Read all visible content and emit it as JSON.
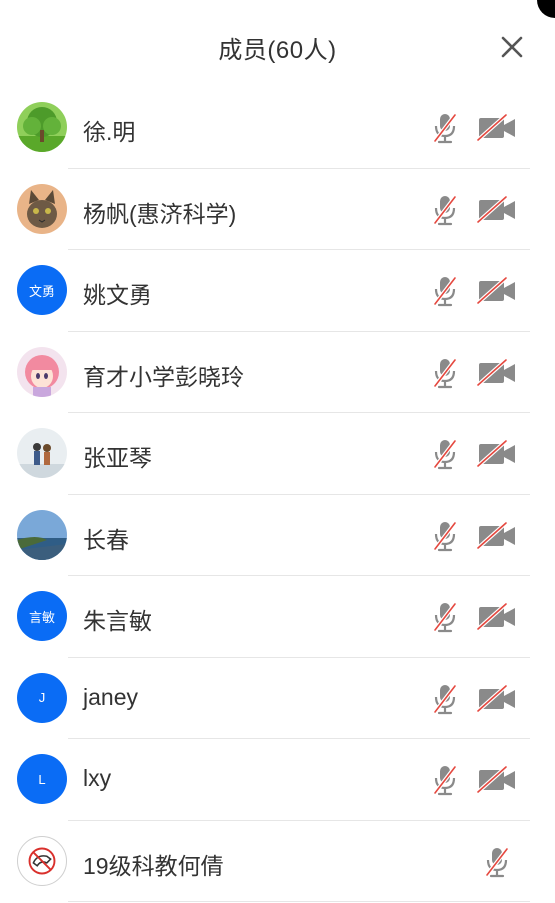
{
  "header": {
    "title": "成员(60人)"
  },
  "members": [
    {
      "name": "徐.明",
      "avatar": {
        "type": "photo",
        "icon": "tree-photo-avatar"
      },
      "mic_muted": true,
      "camera_off": true
    },
    {
      "name": "杨帆(惠济科学)",
      "avatar": {
        "type": "photo",
        "icon": "cat-photo-avatar"
      },
      "mic_muted": true,
      "camera_off": true
    },
    {
      "name": "姚文勇",
      "avatar": {
        "type": "text",
        "text": "文勇"
      },
      "mic_muted": true,
      "camera_off": true
    },
    {
      "name": "育才小学彭晓玲",
      "avatar": {
        "type": "photo",
        "icon": "anime-girl-avatar"
      },
      "mic_muted": true,
      "camera_off": true
    },
    {
      "name": "张亚琴",
      "avatar": {
        "type": "photo",
        "icon": "couple-photo-avatar"
      },
      "mic_muted": true,
      "camera_off": true
    },
    {
      "name": "长春",
      "avatar": {
        "type": "photo",
        "icon": "seascape-photo-avatar"
      },
      "mic_muted": true,
      "camera_off": true
    },
    {
      "name": "朱言敏",
      "avatar": {
        "type": "text",
        "text": "言敏"
      },
      "mic_muted": true,
      "camera_off": true
    },
    {
      "name": "janey",
      "avatar": {
        "type": "text",
        "text": "J"
      },
      "mic_muted": true,
      "camera_off": true
    },
    {
      "name": "lxy",
      "avatar": {
        "type": "text",
        "text": "L"
      },
      "mic_muted": true,
      "camera_off": true
    },
    {
      "name": "19级科教何倩",
      "avatar": {
        "type": "logo",
        "icon": "phone-logo-avatar"
      },
      "mic_muted": true,
      "camera_off": null
    }
  ],
  "colors": {
    "accent": "#0a6cf5",
    "icon_gray": "#8a8a8a",
    "mute_slash": "#e5483f",
    "separator": "#e6e6e6"
  }
}
